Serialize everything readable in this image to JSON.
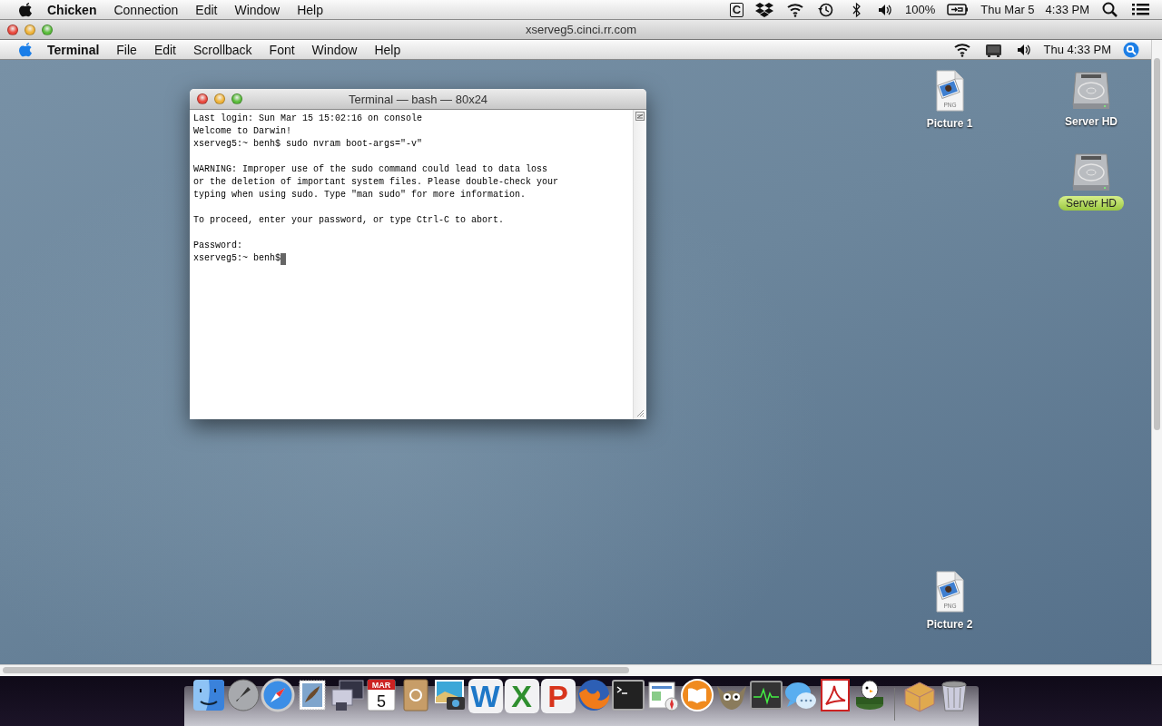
{
  "host_menu_bar": {
    "menus": [
      {
        "label": "Chicken",
        "bold": true
      },
      {
        "label": "Connection",
        "bold": false
      },
      {
        "label": "Edit",
        "bold": false
      },
      {
        "label": "Window",
        "bold": false
      },
      {
        "label": "Help",
        "bold": false
      }
    ],
    "status": [
      {
        "kind": "letter",
        "text": "C"
      },
      {
        "kind": "dropbox"
      },
      {
        "kind": "wifi"
      },
      {
        "kind": "timemachine"
      },
      {
        "kind": "bluetooth"
      },
      {
        "kind": "volume"
      },
      {
        "kind": "text",
        "text": "100%"
      },
      {
        "kind": "battery"
      },
      {
        "kind": "text",
        "text": "Thu Mar 5"
      },
      {
        "kind": "text",
        "text": "4:33 PM"
      },
      {
        "kind": "search"
      },
      {
        "kind": "list"
      }
    ]
  },
  "viewer_window": {
    "title": "xserveg5.cinci.rr.com",
    "active": true
  },
  "remote_menu_bar": {
    "menus": [
      {
        "label": "Terminal",
        "bold": true
      },
      {
        "label": "File",
        "bold": false
      },
      {
        "label": "Edit",
        "bold": false
      },
      {
        "label": "Scrollback",
        "bold": false
      },
      {
        "label": "Font",
        "bold": false
      },
      {
        "label": "Window",
        "bold": false
      },
      {
        "label": "Help",
        "bold": false
      }
    ],
    "status": [
      {
        "kind": "wifi"
      },
      {
        "kind": "display"
      },
      {
        "kind": "volume"
      },
      {
        "kind": "text",
        "text": "Thu 4:33 PM"
      },
      {
        "kind": "spotlight"
      }
    ]
  },
  "terminal": {
    "title": "Terminal — bash — 80x24",
    "active": true,
    "blocks": [
      [
        "Last login: Sun Mar 15 15:02:16 on console",
        "Welcome to Darwin!",
        "xserveg5:~ benh$ sudo nvram boot-args=\"-v\""
      ],
      [
        "WARNING: Improper use of the sudo command could lead to data loss",
        "or the deletion of important system files. Please double-check your",
        "typing when using sudo. Type \"man sudo\" for more information."
      ],
      [
        "To proceed, enter your password, or type Ctrl-C to abort."
      ],
      [
        "Password:",
        "xserveg5:~ benh$"
      ]
    ],
    "cursor": true
  },
  "desktop_icons": [
    {
      "kind": "png",
      "badge": "PNG",
      "label": "Picture 1",
      "selected": false
    },
    {
      "kind": "disk",
      "label": "Server HD",
      "selected": false
    },
    {
      "kind": "disk",
      "label": "Server HD",
      "selected": true
    },
    {
      "kind": "png",
      "badge": "PNG",
      "label": "Picture 2",
      "selected": false
    }
  ],
  "dock": [
    {
      "kind": "finder"
    },
    {
      "kind": "rocket"
    },
    {
      "kind": "compass"
    },
    {
      "kind": "stamp"
    },
    {
      "kind": "screens"
    },
    {
      "kind": "calendar",
      "month": "MAR",
      "day": "5"
    },
    {
      "kind": "addressbook"
    },
    {
      "kind": "camera"
    },
    {
      "kind": "letter",
      "letter": "W",
      "color": "#1f78c8"
    },
    {
      "kind": "letter",
      "letter": "X",
      "color": "#2f8f2f"
    },
    {
      "kind": "letter",
      "letter": "P",
      "color": "#d8341c"
    },
    {
      "kind": "fox"
    },
    {
      "kind": "terminal"
    },
    {
      "kind": "map"
    },
    {
      "kind": "book"
    },
    {
      "kind": "gimp"
    },
    {
      "kind": "monitor"
    },
    {
      "kind": "bubbles"
    },
    {
      "kind": "pdf"
    },
    {
      "kind": "penguin"
    },
    {
      "kind": "separator"
    },
    {
      "kind": "box"
    },
    {
      "kind": "trash"
    }
  ]
}
